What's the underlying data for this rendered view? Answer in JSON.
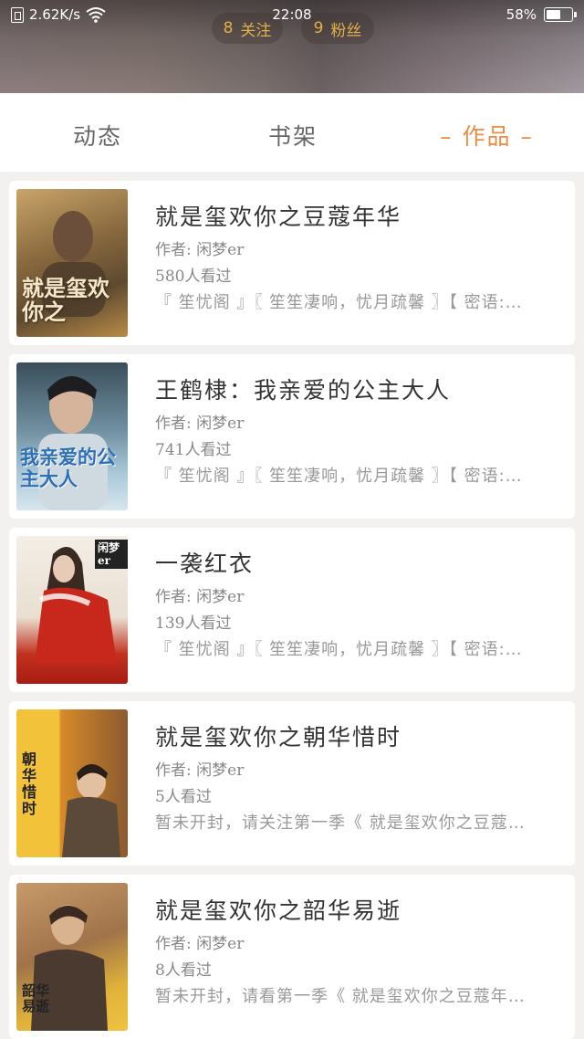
{
  "status_bar": {
    "speed": "2.62K/s",
    "time": "22:08",
    "battery": "58%",
    "battery_level": 0.58
  },
  "profile": {
    "follow_count": "8",
    "follow_label": "关注",
    "fans_count": "9",
    "fans_label": "粉丝"
  },
  "tabs": [
    {
      "label": "动态",
      "active": false
    },
    {
      "label": "书架",
      "active": false
    },
    {
      "label": "– 作品 –",
      "active": true
    }
  ],
  "colors": {
    "accent": "#f08b45",
    "pill_text": "#e2b04a"
  },
  "works": [
    {
      "title": "就是玺欢你之豆蔻年华",
      "author": "作者: 闲梦er",
      "views": "580人看过",
      "desc": "『 笙忧阁 』〖 笙笙凄响，忧月疏馨 〗【 密语:…",
      "cover_text": "就是玺欢你之"
    },
    {
      "title": "王鹤棣：我亲爱的公主大人",
      "author": "作者: 闲梦er",
      "views": "741人看过",
      "desc": "『 笙忧阁 』〖 笙笙凄响，忧月疏馨 〗【 密语:…",
      "cover_text": "我亲爱的公主大人"
    },
    {
      "title": "一袭红衣",
      "author": "作者: 闲梦er",
      "views": "139人看过",
      "desc": "『 笙忧阁 』〖 笙笙凄响，忧月疏馨 〗【 密语:…",
      "cover_text": "闲梦er"
    },
    {
      "title": "就是玺欢你之朝华惜时",
      "author": "作者: 闲梦er",
      "views": "5人看过",
      "desc": "暂未开封，请关注第一季《 就是玺欢你之豆蔻…",
      "cover_text": "朝华惜时"
    },
    {
      "title": "就是玺欢你之韶华易逝",
      "author": "作者: 闲梦er",
      "views": "8人看过",
      "desc": "暂未开封，请看第一季《 就是玺欢你之豆蔻年…",
      "cover_text": "韶华易逝"
    }
  ]
}
